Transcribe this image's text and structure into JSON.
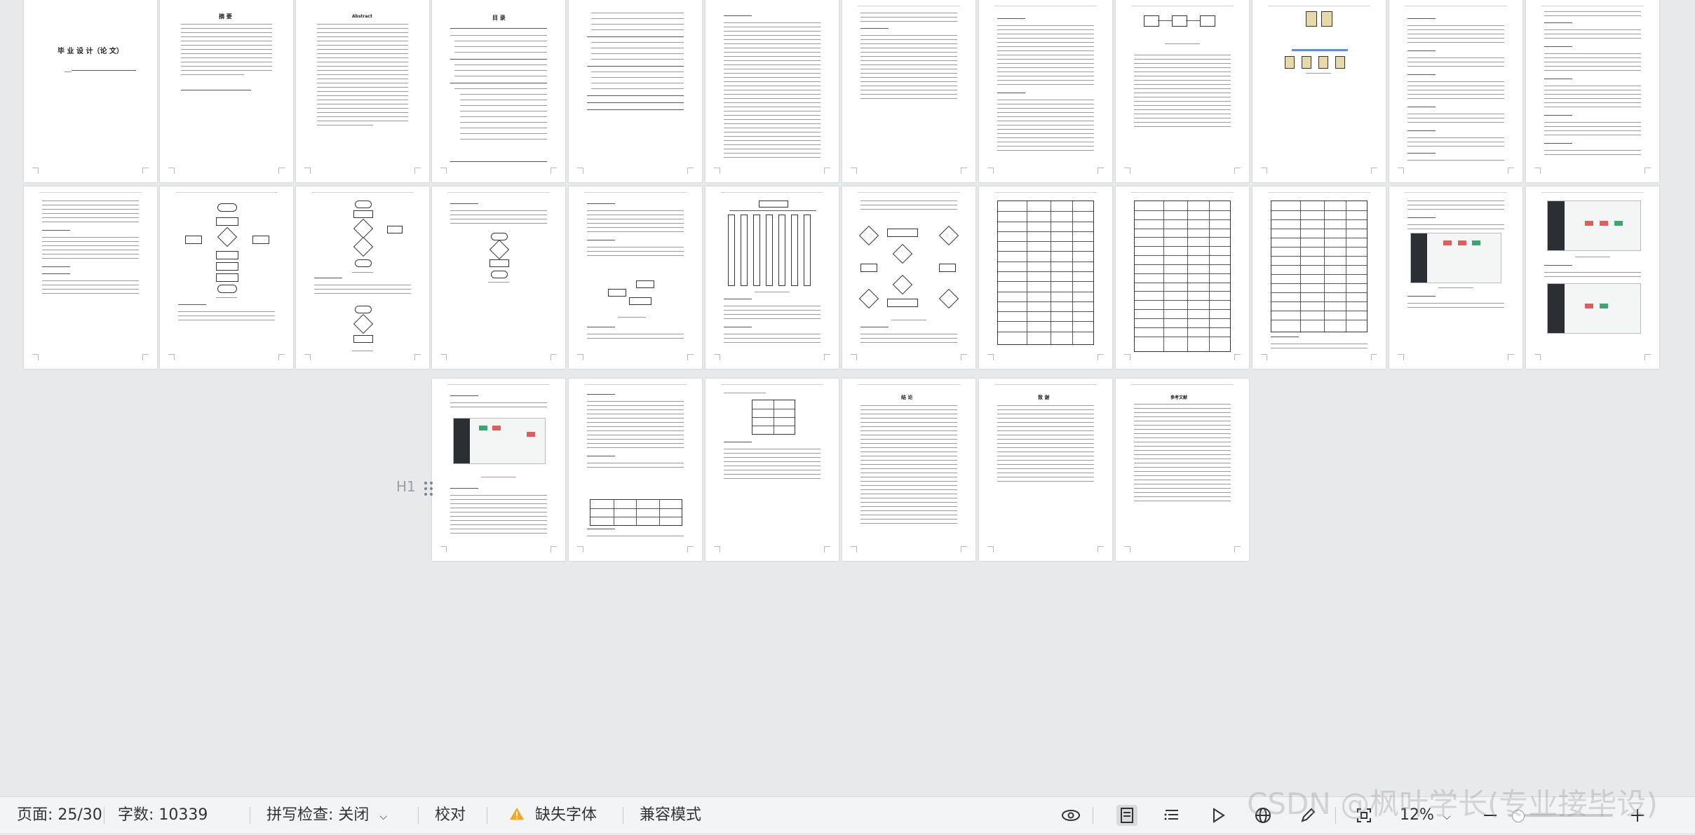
{
  "app": "WPS Writer",
  "status_bar": {
    "page_label": "页面: 25/30",
    "word_count_label": "字数: 10339",
    "spell_check_label": "拼写检查: 关闭",
    "proofread_label": "校对",
    "missing_font_label": "缺失字体",
    "compat_mode_label": "兼容模式",
    "zoom_label": "12%",
    "zoom_level": 12
  },
  "document": {
    "cover_title": "毕 业 设 计（论 文）",
    "abstract_cn_title": "摘 要",
    "abstract_en_title": "Abstract",
    "toc_title": "目 录",
    "conclusion_title": "结 论",
    "thanks_title": "致 谢",
    "references_title": "参考文献"
  },
  "heading_marker": "H1",
  "watermark": "CSDN @枫叶学长(专业接毕设)",
  "colors": {
    "warning_icon": "#f5a623",
    "background": "#e8e9eb",
    "statusbar": "#f3f4f6"
  }
}
